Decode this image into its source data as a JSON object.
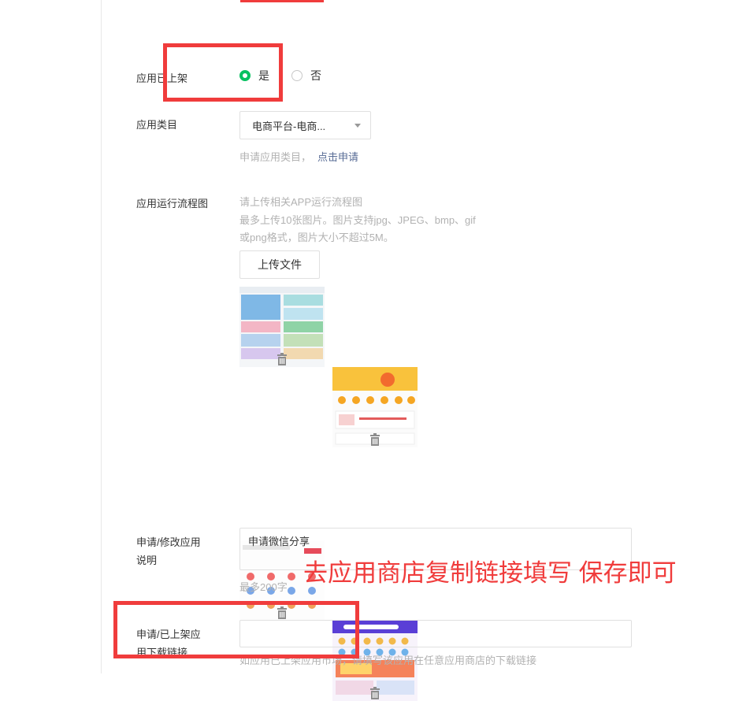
{
  "form": {
    "listed": {
      "label": "应用已上架",
      "options": [
        {
          "label": "是",
          "selected": true
        },
        {
          "label": "否",
          "selected": false
        }
      ]
    },
    "category": {
      "label": "应用类目",
      "selected": "电商平台-电商...",
      "hint": "申请应用类目，",
      "hint_link": "点击申请"
    },
    "flowchart": {
      "label": "应用运行流程图",
      "hint_lines": [
        "请上传相关APP运行流程图",
        "最多上传10张图片。图片支持jpg、JPEG、bmp、gif",
        "或png格式，图片大小不超过5M。"
      ],
      "upload_label": "上传文件",
      "thumbnails": [
        "app-screenshot-1",
        "app-screenshot-2",
        "app-screenshot-3",
        "app-screenshot-4"
      ]
    },
    "description": {
      "label_line1": "申请/修改应用",
      "label_line2": "说明",
      "value": "申请微信分享",
      "hint": "最多200字"
    },
    "download_link": {
      "label_line1": "申请/已上架应",
      "label_line2": "用下载链接",
      "value": "",
      "hint": "如应用已上架应用市场，请填写该应用在任意应用商店的下载链接"
    }
  },
  "annotation": {
    "text": "去应用商店复制链接填写 保存即可",
    "color": "#f03c3c"
  },
  "colors": {
    "radio_selected": "#07c160",
    "link": "#576b95"
  }
}
